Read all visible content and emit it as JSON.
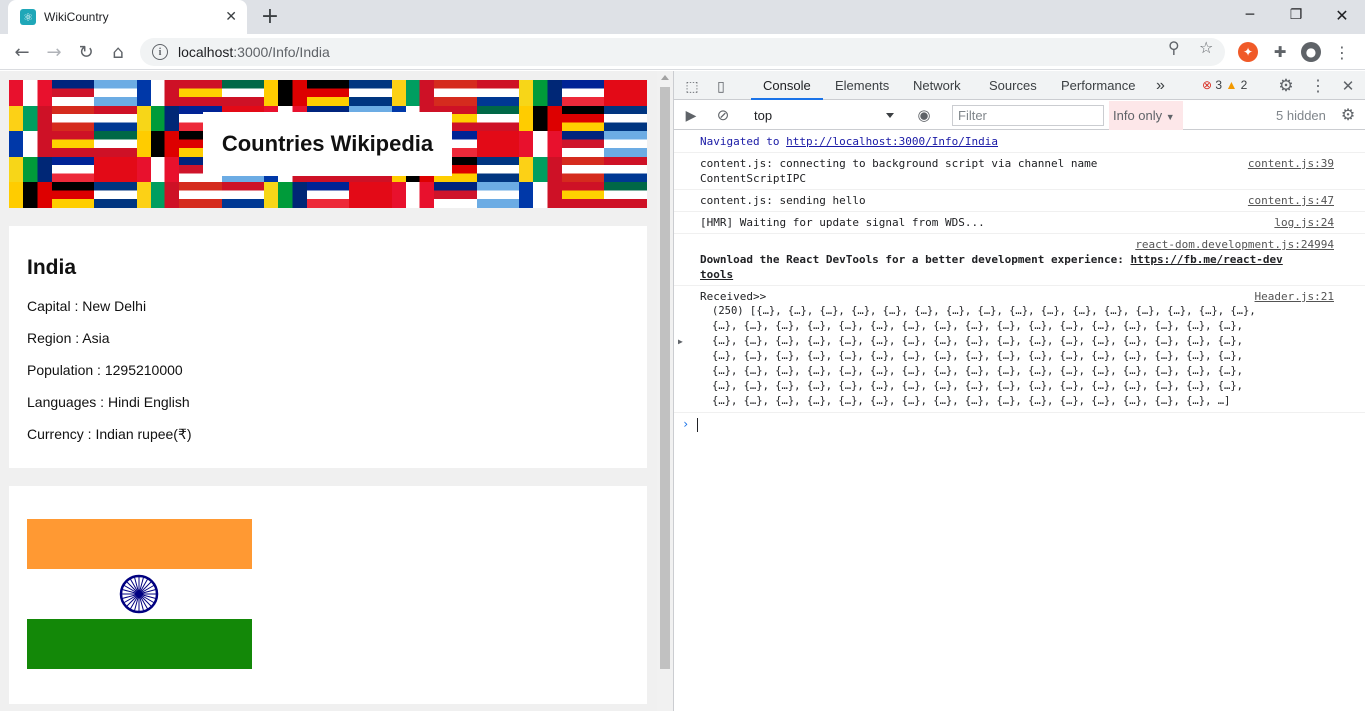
{
  "browser": {
    "tab_title": "WikiCountry",
    "tab_close": "✕",
    "new_tab": "+",
    "url_host": "localhost",
    "url_rest": ":3000/Info/India"
  },
  "page": {
    "banner_title": "Countries Wikipedia",
    "country": {
      "name": "India",
      "capital": "Capital : New Delhi",
      "region": "Region : Asia",
      "population": "Population : 1295210000",
      "languages": "Languages : Hindi English",
      "currency": "Currency : Indian rupee(₹)"
    }
  },
  "devtools": {
    "tabs": [
      "Console",
      "Elements",
      "Network",
      "Sources",
      "Performance"
    ],
    "more_tabs": "»",
    "error_count": "3",
    "warning_count": "2",
    "context": "top",
    "filter_placeholder": "Filter",
    "levels": "Info only",
    "hidden_count": "5 hidden",
    "messages": {
      "nav_prefix": "Navigated to ",
      "nav_url": "http://localhost:3000/Info/India",
      "m1_text": "content.js: connecting to background script via channel name",
      "m1_text2": "ContentScriptIPC",
      "m1_src": "content.js:39",
      "m2_text": "content.js: sending hello",
      "m2_src": "content.js:47",
      "m3_text": "[HMR] Waiting for update signal from WDS...",
      "m3_src": "log.js:24",
      "m4_src": "react-dom.development.js:24994",
      "m4_text": "Download the React DevTools for a better development experience: ",
      "m4_link1": "https://fb.me/react-dev",
      "m4_link2": "tools",
      "m5_text": "Received>>",
      "m5_src": "Header.js:21",
      "m5_line1": "(250) [{…}, {…}, {…}, {…}, {…}, {…}, {…}, {…}, {…}, {…}, {…}, {…}, {…}, {…}, {…}, {…},",
      "m5_line2": "{…}, {…}, {…}, {…}, {…}, {…}, {…}, {…}, {…}, {…}, {…}, {…}, {…}, {…}, {…}, {…}, {…},",
      "m5_line3": "{…}, {…}, {…}, {…}, {…}, {…}, {…}, {…}, {…}, {…}, {…}, {…}, {…}, {…}, {…}, {…}, {…},",
      "m5_line4": "{…}, {…}, {…}, {…}, {…}, {…}, {…}, {…}, {…}, {…}, {…}, {…}, {…}, {…}, {…}, {…}, {…},",
      "m5_line5": "{…}, {…}, {…}, {…}, {…}, {…}, {…}, {…}, {…}, {…}, {…}, {…}, {…}, {…}, {…}, {…}, {…},",
      "m5_line6": "{…}, {…}, {…}, {…}, {…}, {…}, {…}, {…}, {…}, {…}, {…}, {…}, {…}, {…}, {…}, {…}, {…},",
      "m5_line7": "{…}, {…}, {…}, {…}, {…}, {…}, {…}, {…}, {…}, {…}, {…}, {…}, {…}, {…}, {…}, {…}, …]"
    }
  },
  "colors": {
    "flag_saffron": "#ff9933",
    "flag_white": "#ffffff",
    "flag_green": "#138808",
    "chakra": "#000080"
  }
}
